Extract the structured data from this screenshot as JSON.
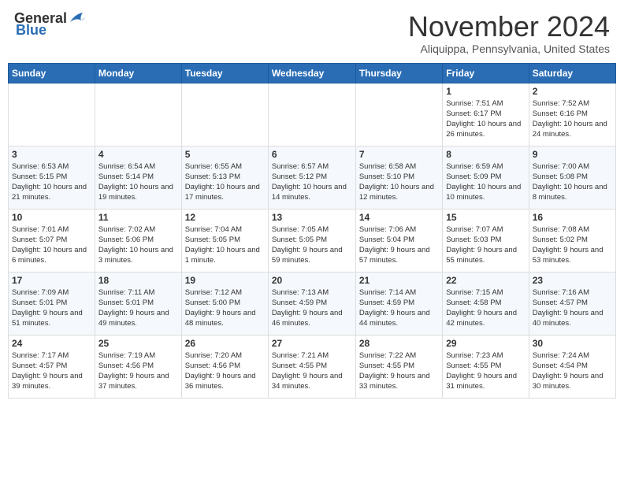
{
  "header": {
    "logo_general": "General",
    "logo_blue": "Blue",
    "month_title": "November 2024",
    "location": "Aliquippa, Pennsylvania, United States"
  },
  "weekdays": [
    "Sunday",
    "Monday",
    "Tuesday",
    "Wednesday",
    "Thursday",
    "Friday",
    "Saturday"
  ],
  "weeks": [
    [
      null,
      null,
      null,
      null,
      null,
      {
        "day": "1",
        "sunrise": "7:51 AM",
        "sunset": "6:17 PM",
        "daylight": "10 hours and 26 minutes."
      },
      {
        "day": "2",
        "sunrise": "7:52 AM",
        "sunset": "6:16 PM",
        "daylight": "10 hours and 24 minutes."
      }
    ],
    [
      {
        "day": "3",
        "sunrise": "6:53 AM",
        "sunset": "5:15 PM",
        "daylight": "10 hours and 21 minutes."
      },
      {
        "day": "4",
        "sunrise": "6:54 AM",
        "sunset": "5:14 PM",
        "daylight": "10 hours and 19 minutes."
      },
      {
        "day": "5",
        "sunrise": "6:55 AM",
        "sunset": "5:13 PM",
        "daylight": "10 hours and 17 minutes."
      },
      {
        "day": "6",
        "sunrise": "6:57 AM",
        "sunset": "5:12 PM",
        "daylight": "10 hours and 14 minutes."
      },
      {
        "day": "7",
        "sunrise": "6:58 AM",
        "sunset": "5:10 PM",
        "daylight": "10 hours and 12 minutes."
      },
      {
        "day": "8",
        "sunrise": "6:59 AM",
        "sunset": "5:09 PM",
        "daylight": "10 hours and 10 minutes."
      },
      {
        "day": "9",
        "sunrise": "7:00 AM",
        "sunset": "5:08 PM",
        "daylight": "10 hours and 8 minutes."
      }
    ],
    [
      {
        "day": "10",
        "sunrise": "7:01 AM",
        "sunset": "5:07 PM",
        "daylight": "10 hours and 6 minutes."
      },
      {
        "day": "11",
        "sunrise": "7:02 AM",
        "sunset": "5:06 PM",
        "daylight": "10 hours and 3 minutes."
      },
      {
        "day": "12",
        "sunrise": "7:04 AM",
        "sunset": "5:05 PM",
        "daylight": "10 hours and 1 minute."
      },
      {
        "day": "13",
        "sunrise": "7:05 AM",
        "sunset": "5:05 PM",
        "daylight": "9 hours and 59 minutes."
      },
      {
        "day": "14",
        "sunrise": "7:06 AM",
        "sunset": "5:04 PM",
        "daylight": "9 hours and 57 minutes."
      },
      {
        "day": "15",
        "sunrise": "7:07 AM",
        "sunset": "5:03 PM",
        "daylight": "9 hours and 55 minutes."
      },
      {
        "day": "16",
        "sunrise": "7:08 AM",
        "sunset": "5:02 PM",
        "daylight": "9 hours and 53 minutes."
      }
    ],
    [
      {
        "day": "17",
        "sunrise": "7:09 AM",
        "sunset": "5:01 PM",
        "daylight": "9 hours and 51 minutes."
      },
      {
        "day": "18",
        "sunrise": "7:11 AM",
        "sunset": "5:01 PM",
        "daylight": "9 hours and 49 minutes."
      },
      {
        "day": "19",
        "sunrise": "7:12 AM",
        "sunset": "5:00 PM",
        "daylight": "9 hours and 48 minutes."
      },
      {
        "day": "20",
        "sunrise": "7:13 AM",
        "sunset": "4:59 PM",
        "daylight": "9 hours and 46 minutes."
      },
      {
        "day": "21",
        "sunrise": "7:14 AM",
        "sunset": "4:59 PM",
        "daylight": "9 hours and 44 minutes."
      },
      {
        "day": "22",
        "sunrise": "7:15 AM",
        "sunset": "4:58 PM",
        "daylight": "9 hours and 42 minutes."
      },
      {
        "day": "23",
        "sunrise": "7:16 AM",
        "sunset": "4:57 PM",
        "daylight": "9 hours and 40 minutes."
      }
    ],
    [
      {
        "day": "24",
        "sunrise": "7:17 AM",
        "sunset": "4:57 PM",
        "daylight": "9 hours and 39 minutes."
      },
      {
        "day": "25",
        "sunrise": "7:19 AM",
        "sunset": "4:56 PM",
        "daylight": "9 hours and 37 minutes."
      },
      {
        "day": "26",
        "sunrise": "7:20 AM",
        "sunset": "4:56 PM",
        "daylight": "9 hours and 36 minutes."
      },
      {
        "day": "27",
        "sunrise": "7:21 AM",
        "sunset": "4:55 PM",
        "daylight": "9 hours and 34 minutes."
      },
      {
        "day": "28",
        "sunrise": "7:22 AM",
        "sunset": "4:55 PM",
        "daylight": "9 hours and 33 minutes."
      },
      {
        "day": "29",
        "sunrise": "7:23 AM",
        "sunset": "4:55 PM",
        "daylight": "9 hours and 31 minutes."
      },
      {
        "day": "30",
        "sunrise": "7:24 AM",
        "sunset": "4:54 PM",
        "daylight": "9 hours and 30 minutes."
      }
    ]
  ]
}
